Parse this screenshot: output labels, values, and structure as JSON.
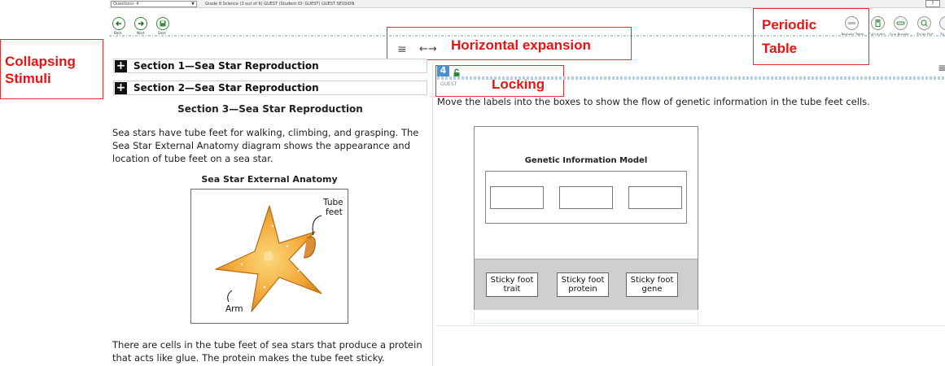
{
  "topbar": {
    "question_select": "Questions: 4",
    "info": "Grade 8 Science (3 out of 6)   GUEST (Student ID: GUEST)   GUEST SESSION",
    "help": "?"
  },
  "toolbar": {
    "back_label": "Back",
    "next_label": "Next",
    "save_label": "Save",
    "tools": [
      "Periodic Table",
      "Calculator",
      "Line Reader",
      "Zoom Out",
      "Zo"
    ]
  },
  "annotations": {
    "collapsing_stimuli": [
      "Collapsing",
      "Stimuli"
    ],
    "horizontal_expansion": "Horizontal expansion",
    "periodic_table": [
      "Periodic",
      "Table"
    ],
    "locking": "Locking"
  },
  "stimulus": {
    "sections": [
      {
        "label": "Section 1—Sea Star Reproduction",
        "expand": "+"
      },
      {
        "label": "Section 2—Sea Star Reproduction",
        "expand": "+"
      }
    ],
    "section3_title": "Section 3—Sea Star Reproduction",
    "para1": "Sea stars have tube feet for walking, climbing, and grasping. The Sea Star External Anatomy diagram shows the appearance and location of tube feet on a sea star.",
    "figure_title": "Sea Star External Anatomy",
    "figure_labels": {
      "tube_feet": [
        "Tube",
        "feet"
      ],
      "arm": "Arm"
    },
    "para2": "There are cells in the tube feet of sea stars that produce a protein that acts like glue. The protein makes the tube feet sticky."
  },
  "item": {
    "number": "4",
    "guest": "GUEST",
    "prompt": "Move the labels into the boxes to show the flow of genetic information in the tube feet cells.",
    "model_title": "Genetic Information Model",
    "chips": [
      [
        "Sticky foot",
        "trait"
      ],
      [
        "Sticky foot",
        "protein"
      ],
      [
        "Sticky foot",
        "gene"
      ]
    ]
  },
  "colors": {
    "accent_blue": "#4a8fd0",
    "annotation_red": "#ee1111",
    "nav_green": "#3a8a3a"
  }
}
